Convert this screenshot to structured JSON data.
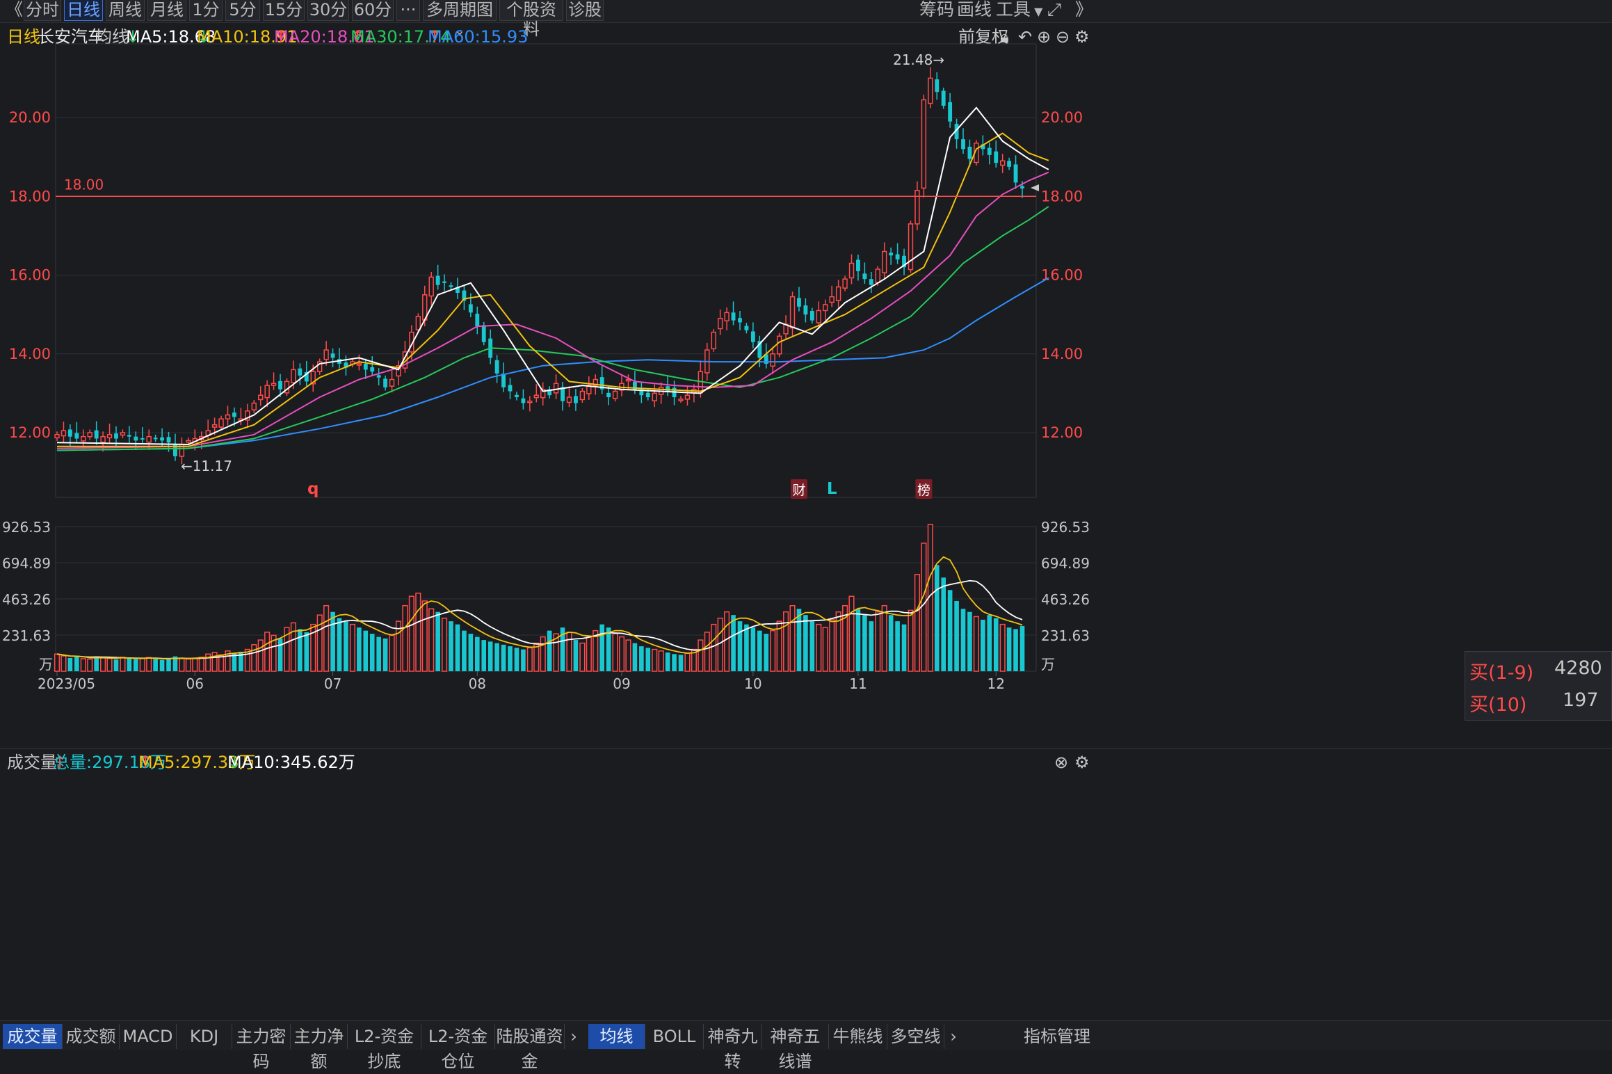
{
  "toolbar": {
    "nav_back": "《",
    "nav_forward": "》",
    "tabs": [
      "分时",
      "日线",
      "周线",
      "月线",
      "1分",
      "5分",
      "15分",
      "30分",
      "60分",
      "···",
      "多周期图",
      "个股资料",
      "诊股"
    ],
    "active_tab": "日线",
    "right_items": [
      "筹码",
      "画线",
      "工具"
    ]
  },
  "info": {
    "period": "日线",
    "stock_name": "长安汽车",
    "ma_label": "均线",
    "ma5": "MA5:18.68",
    "ma10": "MA10:18.91",
    "ma20": "MA20:18.61",
    "ma30": "MA30:17.74",
    "ma60": "MA60:15.93",
    "adjust": "前复权"
  },
  "volume_info": {
    "label": "成交量",
    "total": "总量:297.18万",
    "ma5": "MA5:297.33万",
    "ma10": "MA10:345.62万",
    "unit": "万"
  },
  "order_box": {
    "buy19_label": "买(1-9)",
    "buy19_value": "4280",
    "buy10_label": "买(10)",
    "buy10_value": "197"
  },
  "bottom_tabs_left": [
    "成交量",
    "成交额",
    "MACD",
    "KDJ",
    "主力密码",
    "主力净额",
    "L2-资金抄底",
    "L2-资金仓位",
    "陆股通资金"
  ],
  "bottom_tabs_right": [
    "均线",
    "BOLL",
    "神奇九转",
    "神奇五线谱",
    "牛熊线",
    "多空线"
  ],
  "bottom_right_label": "指标管理",
  "colors": {
    "up": "#ff4a4a",
    "down": "#19c7d0",
    "ma5": "#ffffff",
    "ma10": "#f2c30f",
    "ma20": "#e84fc0",
    "ma30": "#25c95a",
    "ma60": "#2f8fff"
  },
  "chart_data": {
    "type": "candlestick",
    "price_ticks": [
      "12.00",
      "14.00",
      "16.00",
      "18.00",
      "20.00"
    ],
    "volume_ticks": [
      "231.63",
      "463.26",
      "694.89",
      "926.53"
    ],
    "month_labels": [
      {
        "label": "2023/05",
        "index": 0
      },
      {
        "label": "06",
        "index": 21
      },
      {
        "label": "07",
        "index": 42
      },
      {
        "label": "08",
        "index": 64
      },
      {
        "label": "09",
        "index": 86
      },
      {
        "label": "10",
        "index": 106
      },
      {
        "label": "11",
        "index": 122
      },
      {
        "label": "12",
        "index": 143
      }
    ],
    "hline_value": "18.00",
    "high_label": "21.48→",
    "high_value": 21.48,
    "high_index": 136,
    "low_label": "←11.17",
    "low_value": 11.17,
    "low_index": 18,
    "event_markers": [
      {
        "text": "q",
        "index": 39,
        "style": "plain"
      },
      {
        "text": "财",
        "index": 113,
        "style": "box"
      },
      {
        "text": "L",
        "index": 118,
        "style": "plain-blue"
      },
      {
        "text": "榜",
        "index": 132,
        "style": "box"
      }
    ],
    "closes": [
      11.95,
      12.05,
      11.9,
      11.85,
      11.9,
      12.0,
      11.85,
      11.9,
      11.95,
      11.85,
      12.0,
      11.9,
      11.8,
      11.85,
      11.9,
      11.85,
      11.8,
      11.75,
      11.4,
      11.7,
      11.8,
      11.85,
      11.9,
      12.05,
      12.2,
      12.35,
      12.45,
      12.4,
      12.35,
      12.55,
      12.75,
      12.95,
      13.2,
      13.25,
      13.1,
      13.3,
      13.6,
      13.45,
      13.3,
      13.55,
      13.8,
      14.1,
      13.9,
      13.75,
      13.65,
      13.8,
      13.75,
      13.6,
      13.55,
      13.4,
      13.15,
      13.35,
      13.7,
      14.05,
      14.55,
      14.95,
      15.5,
      15.95,
      15.75,
      15.8,
      15.7,
      15.55,
      15.35,
      15.05,
      14.7,
      14.3,
      13.9,
      13.5,
      13.15,
      13.05,
      12.9,
      12.75,
      12.8,
      12.95,
      13.1,
      12.95,
      13.25,
      12.8,
      12.9,
      12.75,
      13.05,
      13.2,
      13.35,
      13.1,
      12.9,
      13.05,
      13.25,
      13.35,
      13.1,
      12.95,
      12.9,
      13.0,
      13.15,
      13.05,
      12.9,
      12.85,
      12.95,
      13.1,
      13.55,
      14.1,
      14.55,
      14.9,
      15.05,
      14.85,
      14.8,
      14.6,
      14.3,
      13.9,
      13.75,
      14.0,
      14.45,
      14.75,
      15.45,
      15.2,
      15.0,
      14.85,
      15.1,
      15.25,
      15.45,
      15.7,
      15.9,
      16.3,
      16.1,
      15.9,
      15.75,
      16.15,
      16.6,
      16.5,
      16.4,
      16.2,
      17.3,
      18.15,
      20.45,
      21.0,
      20.65,
      20.3,
      19.9,
      19.45,
      19.2,
      18.95,
      19.35,
      19.2,
      19.05,
      18.85,
      18.9,
      18.75,
      18.35,
      18.2
    ],
    "volumes": [
      110,
      98,
      85,
      92,
      80,
      78,
      95,
      88,
      82,
      76,
      90,
      85,
      78,
      82,
      88,
      79,
      72,
      80,
      95,
      84,
      78,
      82,
      90,
      110,
      120,
      105,
      130,
      115,
      125,
      140,
      170,
      200,
      250,
      230,
      210,
      280,
      310,
      270,
      250,
      300,
      360,
      420,
      380,
      340,
      320,
      300,
      280,
      260,
      240,
      220,
      210,
      230,
      320,
      420,
      480,
      500,
      450,
      400,
      380,
      340,
      320,
      300,
      260,
      240,
      220,
      200,
      190,
      180,
      170,
      160,
      150,
      140,
      150,
      180,
      220,
      260,
      240,
      280,
      250,
      200,
      180,
      220,
      260,
      300,
      280,
      240,
      220,
      200,
      180,
      160,
      150,
      140,
      130,
      120,
      110,
      105,
      115,
      140,
      200,
      250,
      300,
      340,
      380,
      360,
      320,
      300,
      280,
      260,
      240,
      260,
      320,
      380,
      420,
      400,
      360,
      320,
      300,
      280,
      330,
      380,
      420,
      480,
      400,
      360,
      320,
      380,
      420,
      360,
      320,
      300,
      390,
      620,
      820,
      940,
      680,
      600,
      520,
      450,
      400,
      380,
      350,
      330,
      360,
      340,
      300,
      280,
      270,
      290,
      300,
      297
    ],
    "ma5_points": [
      [
        0,
        11.75
      ],
      [
        20,
        11.7
      ],
      [
        30,
        12.45
      ],
      [
        40,
        13.75
      ],
      [
        46,
        13.9
      ],
      [
        52,
        13.6
      ],
      [
        58,
        15.5
      ],
      [
        63,
        15.8
      ],
      [
        68,
        14.6
      ],
      [
        74,
        13.05
      ],
      [
        80,
        13.2
      ],
      [
        86,
        13.1
      ],
      [
        92,
        13.05
      ],
      [
        98,
        13.0
      ],
      [
        104,
        13.7
      ],
      [
        110,
        14.8
      ],
      [
        115,
        14.5
      ],
      [
        120,
        15.3
      ],
      [
        126,
        15.9
      ],
      [
        132,
        16.6
      ],
      [
        136,
        19.5
      ],
      [
        140,
        20.25
      ],
      [
        144,
        19.4
      ],
      [
        148,
        18.95
      ],
      [
        151,
        18.68
      ]
    ],
    "ma10_points": [
      [
        0,
        11.65
      ],
      [
        20,
        11.65
      ],
      [
        30,
        12.2
      ],
      [
        40,
        13.4
      ],
      [
        46,
        13.8
      ],
      [
        52,
        13.65
      ],
      [
        58,
        14.6
      ],
      [
        62,
        15.4
      ],
      [
        66,
        15.5
      ],
      [
        72,
        14.2
      ],
      [
        78,
        13.3
      ],
      [
        86,
        13.15
      ],
      [
        92,
        13.1
      ],
      [
        98,
        13.05
      ],
      [
        104,
        13.4
      ],
      [
        110,
        14.3
      ],
      [
        115,
        14.65
      ],
      [
        120,
        15.0
      ],
      [
        126,
        15.6
      ],
      [
        132,
        16.2
      ],
      [
        136,
        17.6
      ],
      [
        140,
        19.2
      ],
      [
        144,
        19.6
      ],
      [
        148,
        19.1
      ],
      [
        151,
        18.91
      ]
    ],
    "ma20_points": [
      [
        0,
        11.6
      ],
      [
        20,
        11.65
      ],
      [
        30,
        11.95
      ],
      [
        40,
        12.9
      ],
      [
        46,
        13.35
      ],
      [
        52,
        13.65
      ],
      [
        58,
        14.15
      ],
      [
        64,
        14.7
      ],
      [
        70,
        14.75
      ],
      [
        76,
        14.4
      ],
      [
        82,
        13.8
      ],
      [
        88,
        13.3
      ],
      [
        94,
        13.2
      ],
      [
        100,
        13.15
      ],
      [
        106,
        13.2
      ],
      [
        112,
        13.85
      ],
      [
        118,
        14.3
      ],
      [
        124,
        14.9
      ],
      [
        130,
        15.6
      ],
      [
        136,
        16.5
      ],
      [
        140,
        17.5
      ],
      [
        144,
        18.05
      ],
      [
        148,
        18.4
      ],
      [
        151,
        18.61
      ]
    ],
    "ma30_points": [
      [
        0,
        11.55
      ],
      [
        20,
        11.6
      ],
      [
        30,
        11.85
      ],
      [
        40,
        12.4
      ],
      [
        48,
        12.85
      ],
      [
        56,
        13.4
      ],
      [
        62,
        13.9
      ],
      [
        66,
        14.15
      ],
      [
        72,
        14.1
      ],
      [
        80,
        13.95
      ],
      [
        88,
        13.6
      ],
      [
        96,
        13.35
      ],
      [
        104,
        13.15
      ],
      [
        110,
        13.4
      ],
      [
        118,
        13.9
      ],
      [
        124,
        14.4
      ],
      [
        130,
        14.95
      ],
      [
        134,
        15.6
      ],
      [
        138,
        16.3
      ],
      [
        144,
        17.0
      ],
      [
        148,
        17.4
      ],
      [
        151,
        17.74
      ]
    ],
    "ma60_points": [
      [
        0,
        11.55
      ],
      [
        20,
        11.6
      ],
      [
        30,
        11.8
      ],
      [
        40,
        12.1
      ],
      [
        50,
        12.45
      ],
      [
        58,
        12.9
      ],
      [
        66,
        13.4
      ],
      [
        74,
        13.7
      ],
      [
        82,
        13.8
      ],
      [
        90,
        13.85
      ],
      [
        100,
        13.8
      ],
      [
        110,
        13.8
      ],
      [
        118,
        13.85
      ],
      [
        126,
        13.9
      ],
      [
        132,
        14.1
      ],
      [
        136,
        14.4
      ],
      [
        140,
        14.85
      ],
      [
        146,
        15.45
      ],
      [
        151,
        15.93
      ]
    ]
  }
}
